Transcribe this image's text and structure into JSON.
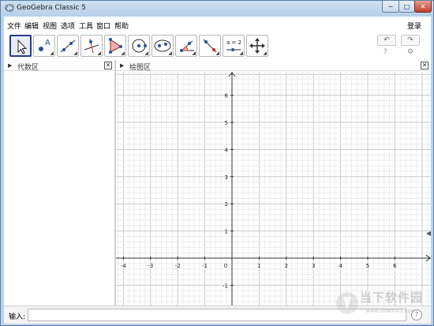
{
  "window": {
    "title": "GeoGebra Classic 5",
    "min_label": "─",
    "max_label": "□",
    "close_label": "✕"
  },
  "menu": {
    "items": [
      "文件",
      "编辑",
      "视图",
      "选项",
      "工具",
      "窗口",
      "帮助"
    ],
    "login": "登录"
  },
  "toolbar": {
    "tools": [
      {
        "name": "move-tool",
        "icon": "arrow-cursor-icon",
        "selected": true
      },
      {
        "name": "point-tool",
        "icon": "point-A-icon",
        "label": "A"
      },
      {
        "name": "line-tool",
        "icon": "line-icon"
      },
      {
        "name": "perpendicular-tool",
        "icon": "perpendicular-line-icon"
      },
      {
        "name": "polygon-tool",
        "icon": "polygon-icon"
      },
      {
        "name": "circle-tool",
        "icon": "circle-center-point-icon"
      },
      {
        "name": "ellipse-tool",
        "icon": "ellipse-icon"
      },
      {
        "name": "angle-tool",
        "icon": "angle-icon"
      },
      {
        "name": "reflect-tool",
        "icon": "reflect-line-icon"
      },
      {
        "name": "slider-tool",
        "icon": "slider-icon",
        "label": "a = 2"
      },
      {
        "name": "move-view-tool",
        "icon": "move-graphics-view-icon"
      }
    ],
    "undo": "↶",
    "redo": "↷",
    "help": "?",
    "settings": "⚙"
  },
  "algebra_panel": {
    "title": "代数区",
    "close": "✕"
  },
  "graphics_panel": {
    "title": "绘图区",
    "close": "✕",
    "x_ticks": [
      "-4",
      "-3",
      "-2",
      "-1",
      "0",
      "1",
      "2",
      "3",
      "4",
      "5",
      "6"
    ],
    "y_ticks": [
      "6",
      "5",
      "4",
      "3",
      "2",
      "1",
      "-1",
      "-2"
    ]
  },
  "input_bar": {
    "label": "输入:",
    "value": "",
    "help": "?"
  },
  "watermark": {
    "text": "当下软件园",
    "url": "www.downxia.com"
  }
}
